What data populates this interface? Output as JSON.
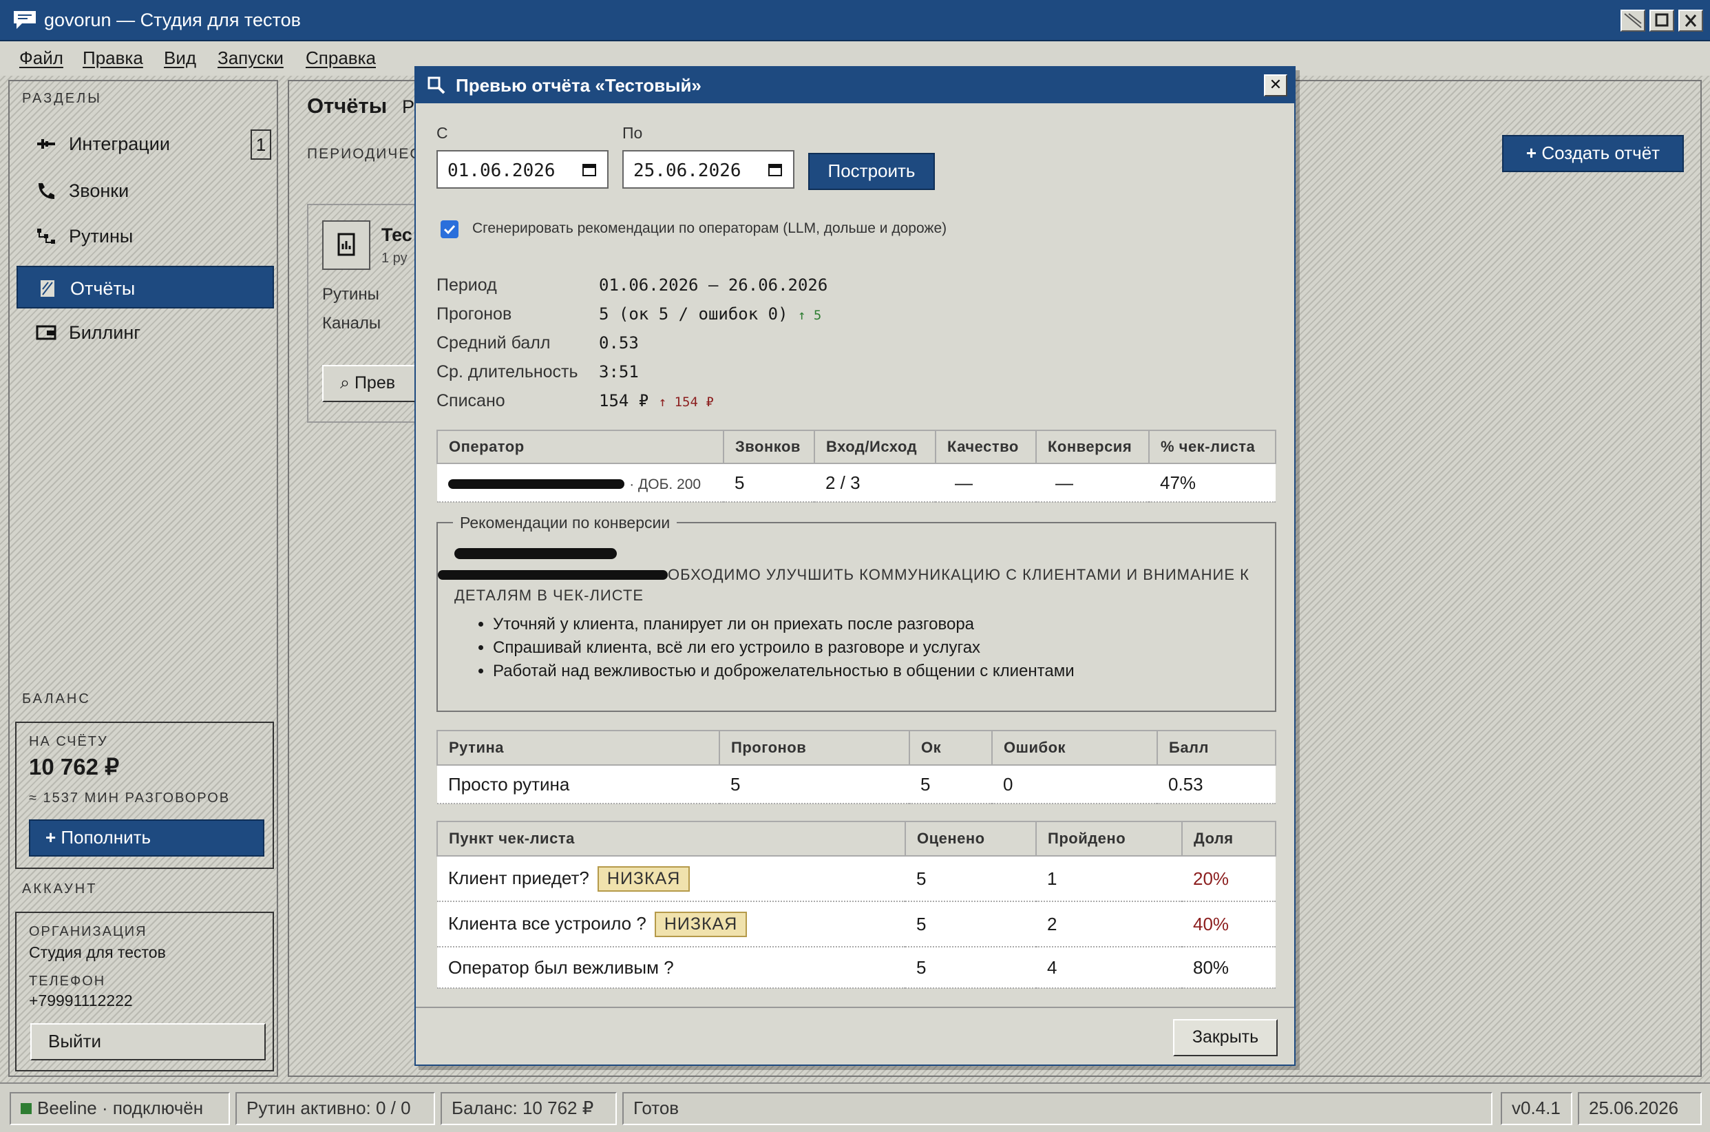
{
  "window": {
    "title": "govorun — Студия для тестов"
  },
  "menu": [
    "Файл",
    "Правка",
    "Вид",
    "Запуски",
    "Справка"
  ],
  "sidebar": {
    "section_label": "РАЗДЕЛЫ",
    "items": [
      {
        "label": "Интеграции",
        "icon": "plug-icon",
        "badge": "1"
      },
      {
        "label": "Звонки",
        "icon": "phone-icon"
      },
      {
        "label": "Рутины",
        "icon": "routine-icon"
      },
      {
        "label": "Отчёты",
        "icon": "report-icon",
        "active": true
      },
      {
        "label": "Биллинг",
        "icon": "wallet-icon"
      }
    ],
    "balance": {
      "section_label": "БАЛАНС",
      "caption": "НА СЧЁТУ",
      "amount": "10 762 ₽",
      "minutes": "≈ 1537 МИН РАЗГОВОРОВ",
      "topup_label": "Пополнить"
    },
    "account": {
      "section_label": "АККАУНТ",
      "org_caption": "ОРГАНИЗАЦИЯ",
      "org": "Студия для тестов",
      "phone_caption": "ТЕЛЕФОН",
      "phone": "+79991112222",
      "logout_label": "Выйти"
    }
  },
  "main": {
    "heading": "Отчёты",
    "heading_tail": "Р",
    "subheading": "ПЕРИОДИЧЕС",
    "card": {
      "title": "Тес",
      "subtitle": "1 ру",
      "row1": "Рутины",
      "row2": "Каналы",
      "preview_label": "Прев"
    },
    "create_label": "Создать отчёт"
  },
  "dialog": {
    "title": "Превью отчёта «Тестовый»",
    "from_label": "С",
    "from_value": "01.06.2026",
    "to_label": "По",
    "to_value": "25.06.2026",
    "build_label": "Построить",
    "llm_checked": true,
    "llm_label": "Сгенерировать рекомендации по операторам (LLM, дольше и дороже)",
    "summary": {
      "period_label": "Период",
      "period_value": "01.06.2026 — 26.06.2026",
      "runs_label": "Прогонов",
      "runs_value": "5 (ок 5 / ошибок 0)",
      "runs_delta": "↑ 5",
      "score_label": "Средний балл",
      "score_value": "0.53",
      "duration_label": "Ср. длительность",
      "duration_value": "3:51",
      "charged_label": "Списано",
      "charged_value": "154 ₽",
      "charged_delta": "↑ 154 ₽"
    },
    "operators": {
      "headers": [
        "Оператор",
        "Звонков",
        "Вход/Исход",
        "Качество",
        "Конверсия",
        "% чек-листа"
      ],
      "rows": [
        {
          "ext": "· ДОБ. 200",
          "calls": "5",
          "inout": "2 / 3",
          "quality": "—",
          "conversion": "—",
          "checklist": "47%"
        }
      ]
    },
    "recommendations": {
      "legend": "Рекомендации по конверсии",
      "summary": "ОБХОДИМО УЛУЧШИТЬ КОММУНИКАЦИЮ С КЛИЕНТАМИ И ВНИМАНИЕ К",
      "summary_cont": "ДЕТАЛЯМ В ЧЕК-ЛИСТЕ",
      "items": [
        "Уточняй у клиента, планирует ли он приехать после разговора",
        "Спрашивай клиента, всё ли его устроило в разговоре и услугах",
        "Работай над вежливостью и доброжелательностью в общении с клиентами"
      ]
    },
    "routines": {
      "headers": [
        "Рутина",
        "Прогонов",
        "Ок",
        "Ошибок",
        "Балл"
      ],
      "rows": [
        {
          "name": "Просто рутина",
          "runs": "5",
          "ok": "5",
          "errors": "0",
          "score": "0.53"
        }
      ]
    },
    "checklist": {
      "headers": [
        "Пункт чек-листа",
        "Оценено",
        "Пройдено",
        "Доля"
      ],
      "rows": [
        {
          "item": "Клиент приедет?",
          "tag": "НИЗКАЯ",
          "rated": "5",
          "passed": "1",
          "share": "20%"
        },
        {
          "item": "Клиента все устроило ?",
          "tag": "НИЗКАЯ",
          "rated": "5",
          "passed": "2",
          "share": "40%"
        },
        {
          "item": "Оператор был вежливым ?",
          "rated": "5",
          "passed": "4",
          "share": "80%"
        }
      ]
    },
    "close_label": "Закрыть"
  },
  "statusbar": {
    "connection": "Beeline · подключён",
    "routines": "Рутин активно: 0 / 0",
    "balance": "Баланс: 10 762 ₽",
    "state": "Готов",
    "version": "v0.4.1",
    "date": "25.06.2026"
  },
  "colors": {
    "accent": "#1e4a80",
    "ok": "#2e7d32",
    "warn": "#8c1f1f",
    "tag_bg": "#f0e2ad"
  }
}
